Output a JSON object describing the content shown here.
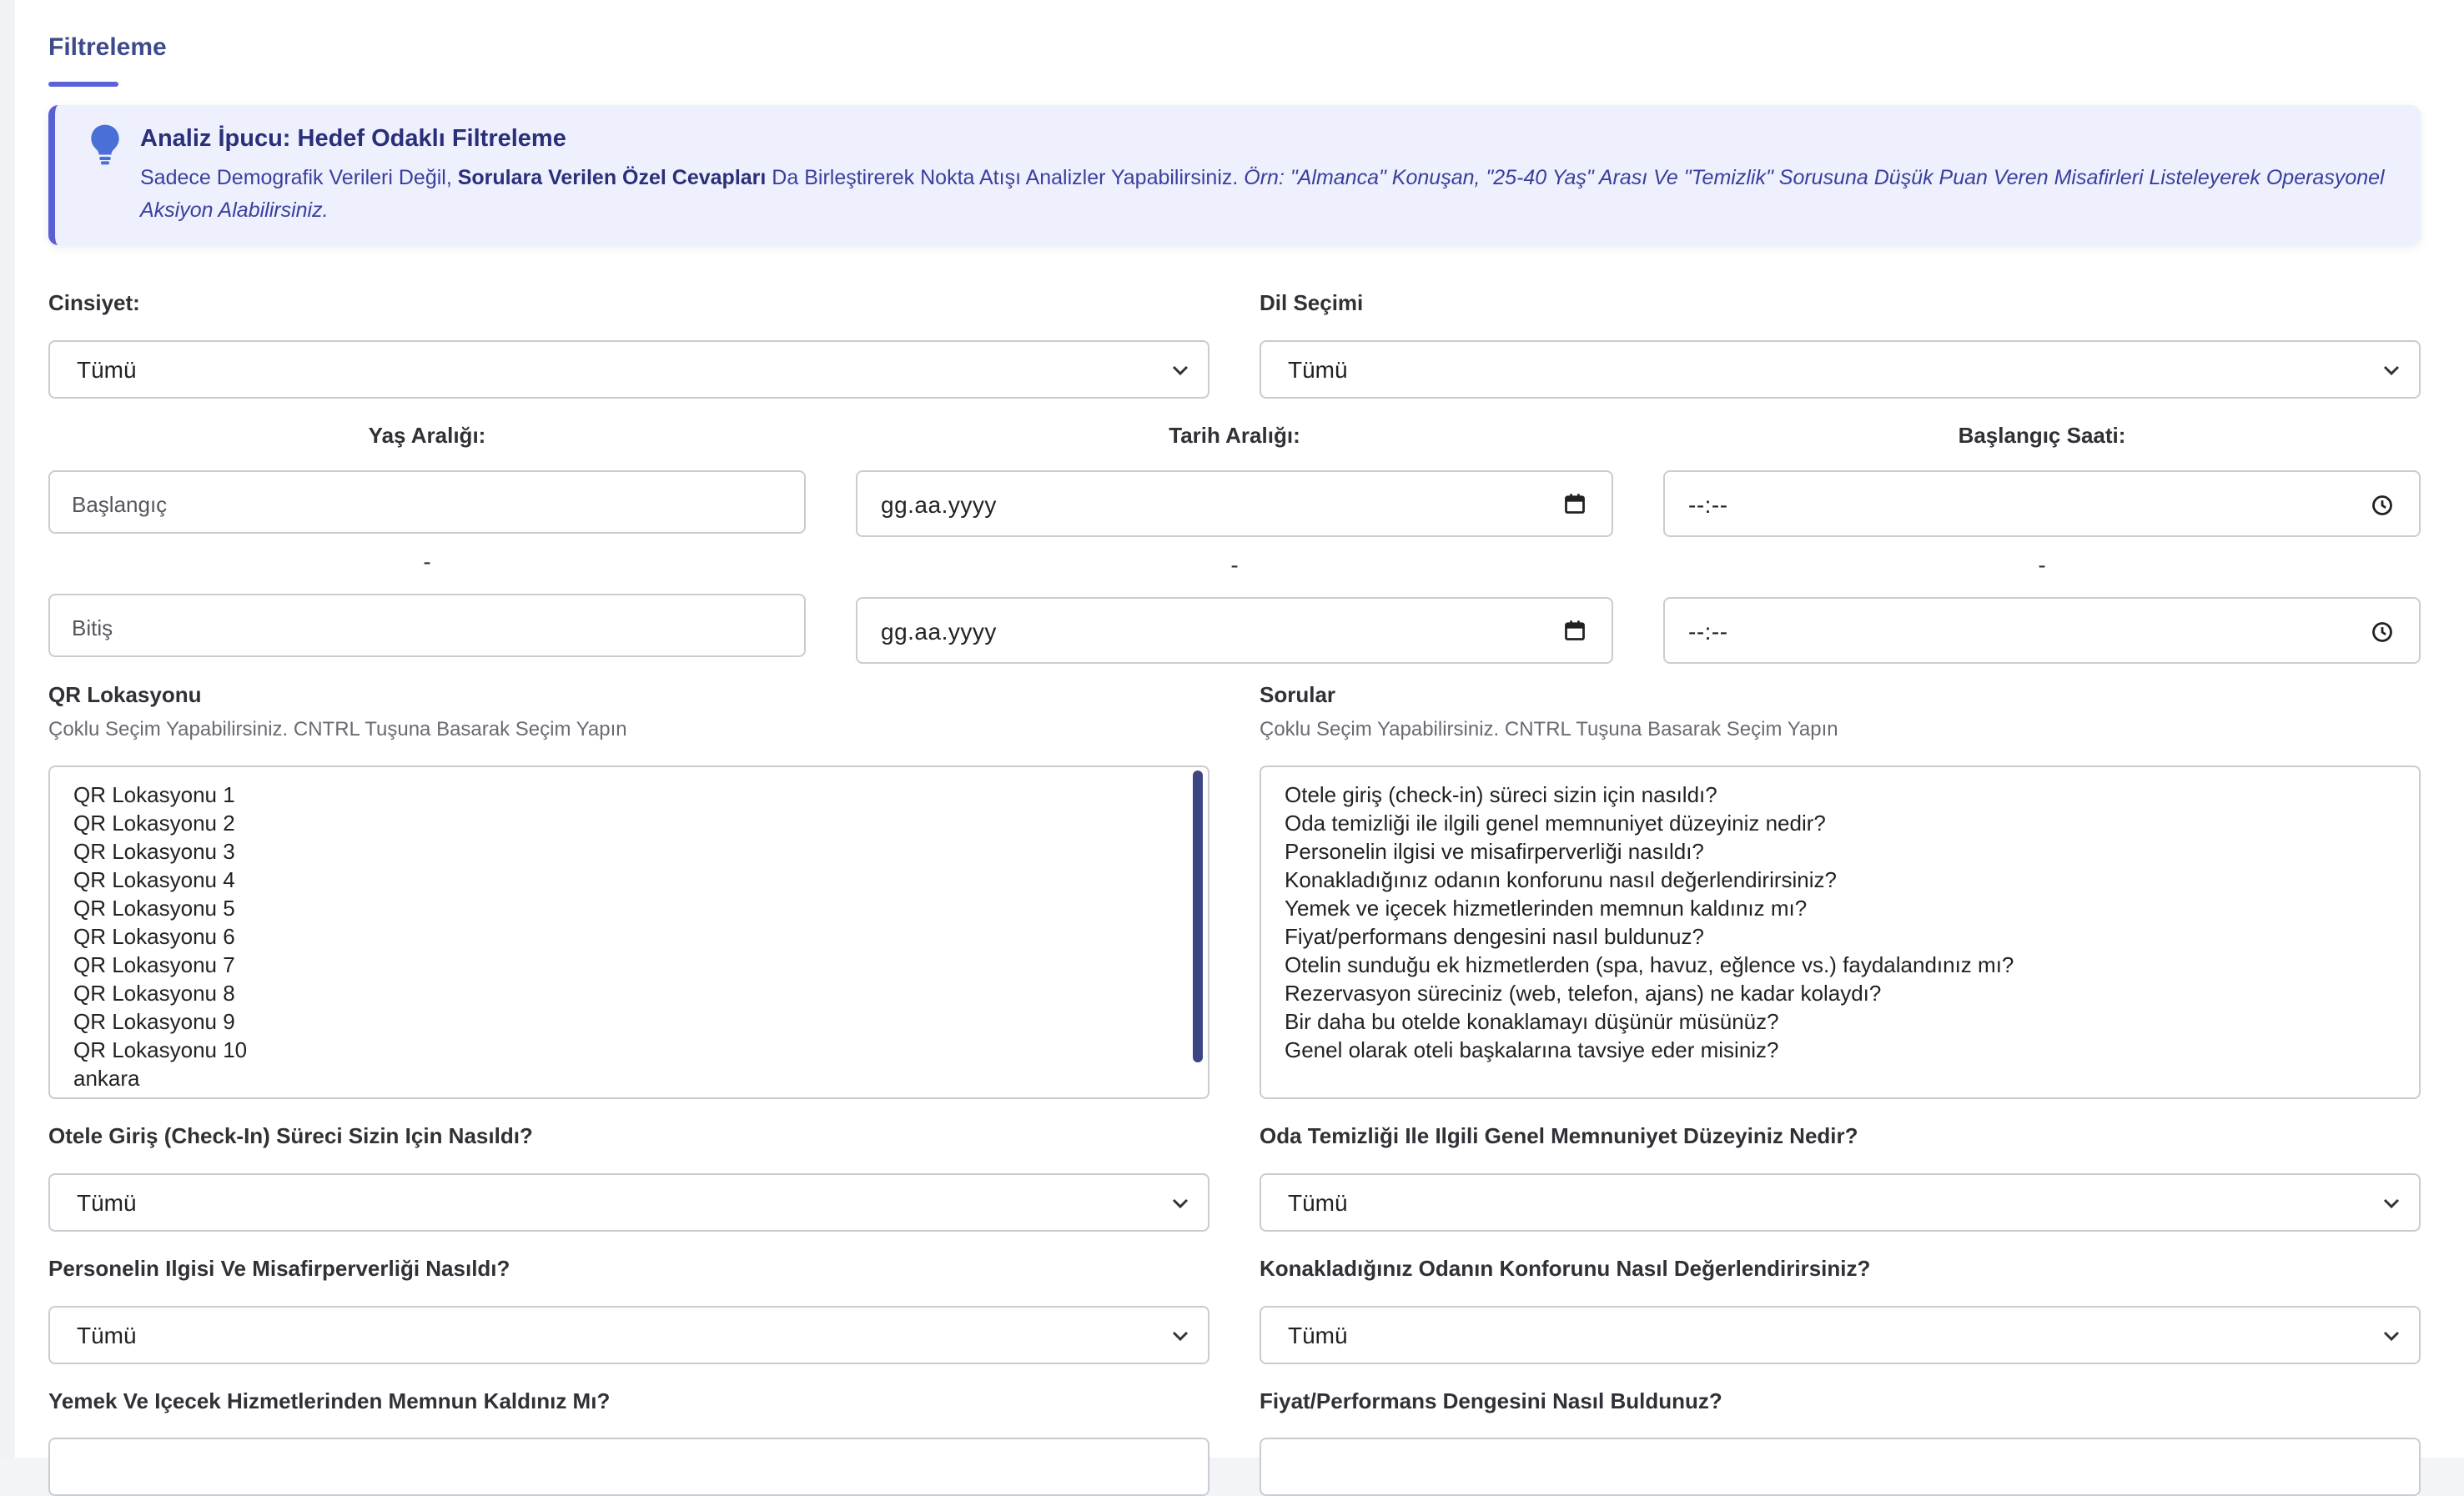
{
  "tab": {
    "title": "Filtreleme"
  },
  "tip": {
    "title": "Analiz İpucu: Hedef Odaklı Filtreleme",
    "body_part1": "Sadece Demografik Verileri Değil, ",
    "body_bold": "Sorulara Verilen Özel Cevapları",
    "body_part2": " Da Birleştirerek Nokta Atışı Analizler Yapabilirsiniz. ",
    "body_example": "Örn: \"Almanca\" Konuşan, \"25-40 Yaş\" Arası Ve \"Temizlik\" Sorusuna Düşük Puan Veren Misafirleri Listeleyerek Operasyonel Aksiyon Alabilirsiniz.",
    "icon": "lightbulb-icon"
  },
  "filters": {
    "gender": {
      "label": "Cinsiyet:",
      "value": "Tümü"
    },
    "language": {
      "label": "Dil Seçimi",
      "value": "Tümü"
    },
    "age": {
      "label": "Yaş Aralığı:",
      "start_placeholder": "Başlangıç",
      "end_placeholder": "Bitiş",
      "separator": "-"
    },
    "date": {
      "label": "Tarih Aralığı:",
      "start_value": "gg.aa.yyyy",
      "end_value": "gg.aa.yyyy",
      "separator": "-"
    },
    "time": {
      "label": "Başlangıç Saati:",
      "start_value": "--:--",
      "end_value": "--:--",
      "separator": "-"
    },
    "qr": {
      "label": "QR Lokasyonu",
      "hint": "Çoklu Seçim Yapabilirsiniz. CNTRL Tuşuna Basarak Seçim Yapın",
      "options": [
        "QR Lokasyonu 1",
        "QR Lokasyonu 2",
        "QR Lokasyonu 3",
        "QR Lokasyonu 4",
        "QR Lokasyonu 5",
        "QR Lokasyonu 6",
        "QR Lokasyonu 7",
        "QR Lokasyonu 8",
        "QR Lokasyonu 9",
        "QR Lokasyonu 10",
        "ankara"
      ]
    },
    "questions": {
      "label": "Sorular",
      "hint": "Çoklu Seçim Yapabilirsiniz. CNTRL Tuşuna Basarak Seçim Yapın",
      "options": [
        "Otele giriş (check-in) süreci sizin için nasıldı?",
        "Oda temizliği ile ilgili genel memnuniyet düzeyiniz nedir?",
        "Personelin ilgisi ve misafirperverliği nasıldı?",
        "Konakladığınız odanın konforunu nasıl değerlendirirsiniz?",
        "Yemek ve içecek hizmetlerinden memnun kaldınız mı?",
        "Fiyat/performans dengesini nasıl buldunuz?",
        "Otelin sunduğu ek hizmetlerden (spa, havuz, eğlence vs.) faydalandınız mı?",
        "Rezervasyon süreciniz (web, telefon, ajans) ne kadar kolaydı?",
        "Bir daha bu otelde konaklamayı düşünür müsünüz?",
        "Genel olarak oteli başkalarına tavsiye eder misiniz?"
      ]
    },
    "q_checkin": {
      "label": "Otele Giriş (Check-In) Süreci Sizin Için Nasıldı?",
      "value": "Tümü"
    },
    "q_cleaning": {
      "label": "Oda Temizliği Ile Ilgili Genel Memnuniyet Düzeyiniz Nedir?",
      "value": "Tümü"
    },
    "q_staff": {
      "label": "Personelin Ilgisi Ve Misafirperverliği Nasıldı?",
      "value": "Tümü"
    },
    "q_comfort": {
      "label": "Konakladığınız Odanın Konforunu Nasıl Değerlendirirsiniz?",
      "value": "Tümü"
    },
    "q_food": {
      "label": "Yemek Ve Içecek Hizmetlerinden Memnun Kaldınız Mı?"
    },
    "q_price": {
      "label": "Fiyat/Performans Dengesini Nasıl Buldunuz?"
    }
  },
  "colors": {
    "accent": "#5a5fd6",
    "title": "#3d4b8c",
    "tip_bg": "#eef0fd",
    "scrollbar": "#3d4585"
  }
}
